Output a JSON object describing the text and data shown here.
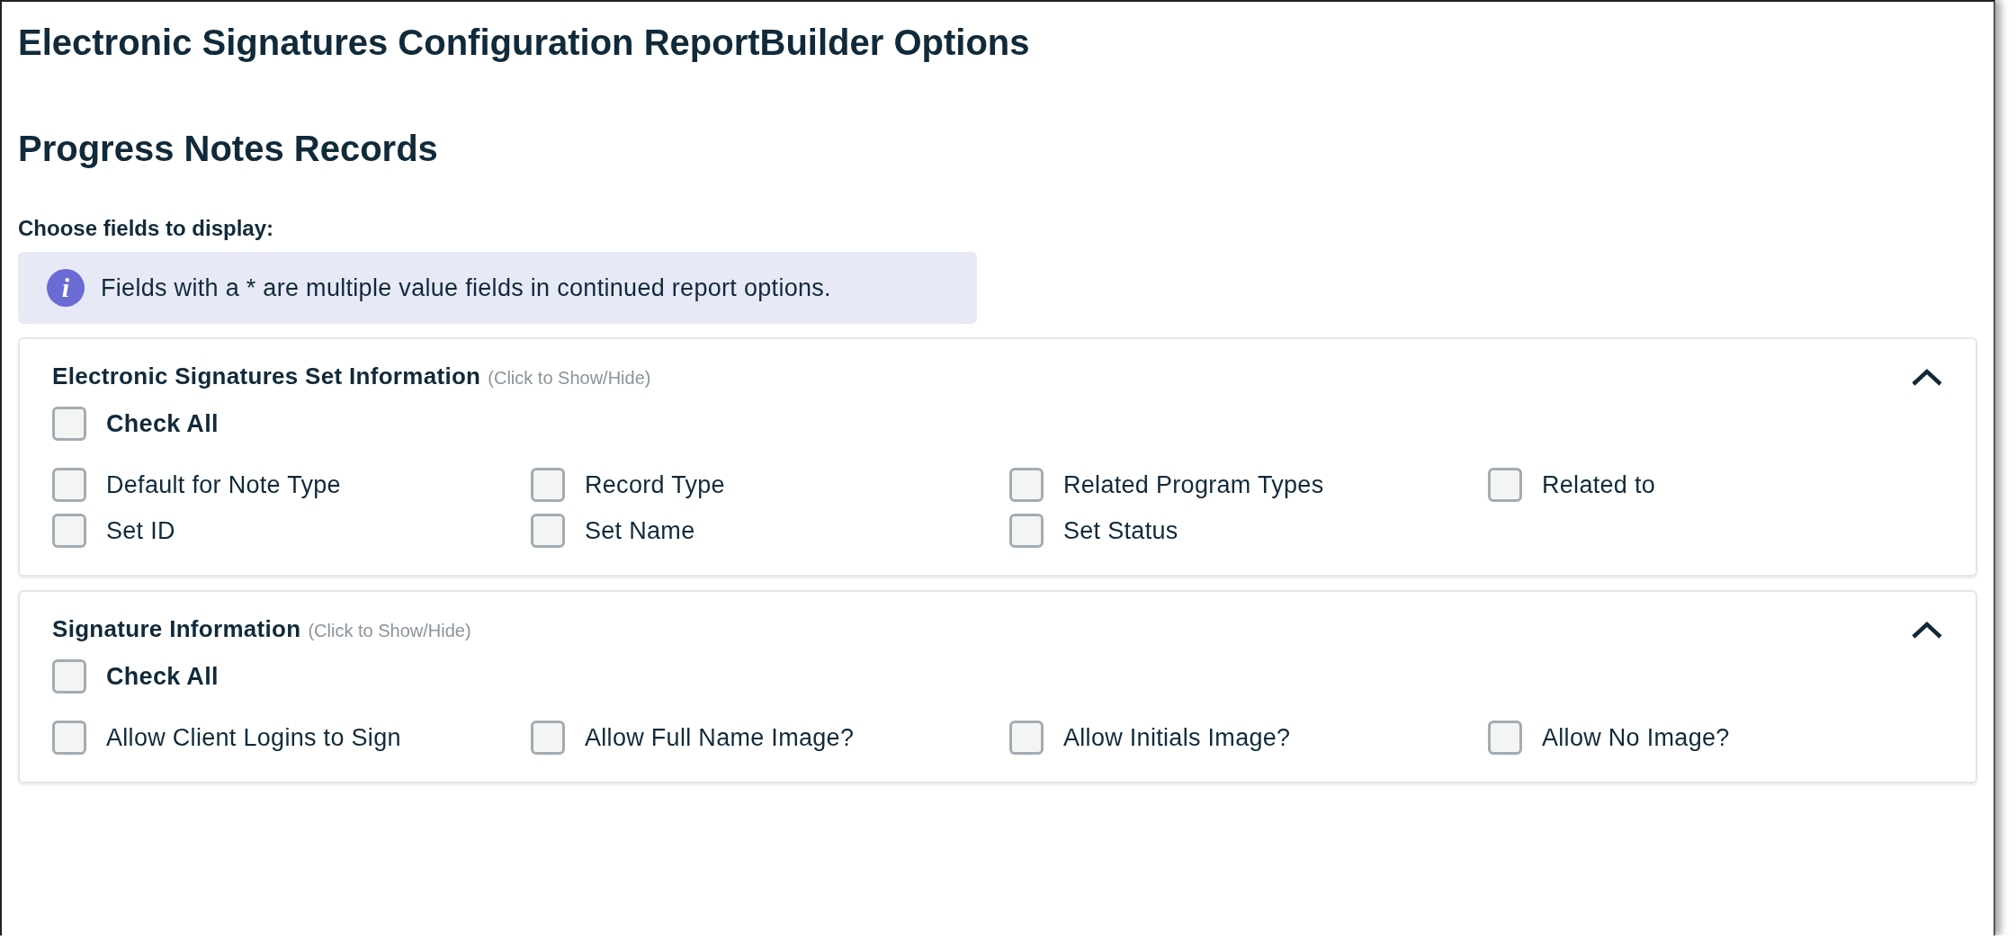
{
  "title": "Electronic Signatures Configuration ReportBuilder Options",
  "subtitle": "Progress Notes Records",
  "choose_label": "Choose fields to display:",
  "info": {
    "icon_glyph": "i",
    "text": "Fields with a * are multiple value fields in continued report options."
  },
  "sections": [
    {
      "title": "Electronic Signatures Set Information",
      "hint": "(Click to Show/Hide)",
      "expanded": true,
      "check_all": {
        "label": "Check All",
        "checked": false
      },
      "fields": [
        {
          "label": "Default for Note Type",
          "checked": false
        },
        {
          "label": "Record Type",
          "checked": false
        },
        {
          "label": "Related Program Types",
          "checked": false
        },
        {
          "label": "Related to",
          "checked": false
        },
        {
          "label": "Set ID",
          "checked": false
        },
        {
          "label": "Set Name",
          "checked": false
        },
        {
          "label": "Set Status",
          "checked": false
        }
      ]
    },
    {
      "title": "Signature Information",
      "hint": "(Click to Show/Hide)",
      "expanded": true,
      "check_all": {
        "label": "Check All",
        "checked": false
      },
      "fields": [
        {
          "label": "Allow Client Logins to Sign",
          "checked": false
        },
        {
          "label": "Allow Full Name Image?",
          "checked": false
        },
        {
          "label": "Allow Initials Image?",
          "checked": false
        },
        {
          "label": "Allow No Image?",
          "checked": false
        }
      ]
    }
  ]
}
